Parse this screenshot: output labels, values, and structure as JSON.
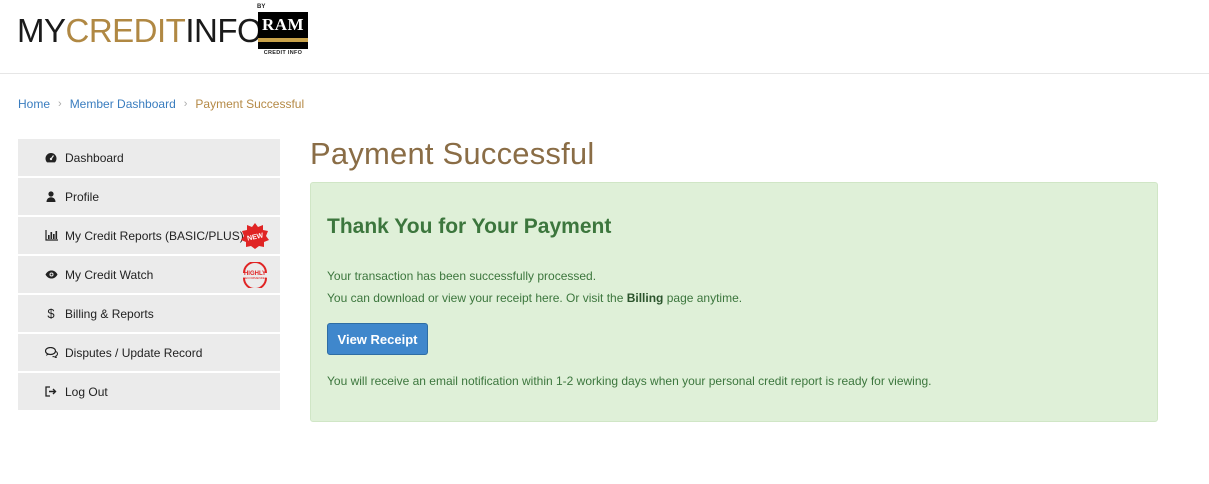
{
  "logo": {
    "my": "MY",
    "credit": "CREDIT",
    "info": "INFO",
    "by": "BY",
    "ram": "RAM",
    "ram_sub": "CREDIT INFO"
  },
  "breadcrumb": {
    "items": [
      "Home",
      "Member Dashboard"
    ],
    "current": "Payment Successful",
    "separator_icon": "chevron-right-icon"
  },
  "sidebar": {
    "items": [
      {
        "label": "Dashboard",
        "icon": "dashboard-icon"
      },
      {
        "label": "Profile",
        "icon": "user-icon"
      },
      {
        "label": "My Credit Reports (BASIC/PLUS)",
        "icon": "bar-chart-icon",
        "badge": "NEW"
      },
      {
        "label": "My Credit Watch",
        "icon": "eye-icon",
        "badge": "HIGHLY RECOMMENDED"
      },
      {
        "label": "Billing & Reports",
        "icon": "dollar-icon"
      },
      {
        "label": "Disputes / Update Record",
        "icon": "comments-icon"
      },
      {
        "label": "Log Out",
        "icon": "sign-out-icon"
      }
    ]
  },
  "main": {
    "title": "Payment Successful",
    "panel": {
      "heading": "Thank You for Your Payment",
      "line1": "Your transaction has been successfully processed.",
      "line2_pre": "You can download or view your receipt here. Or visit the ",
      "line2_bold": "Billing",
      "line2_post": " page anytime.",
      "button_label": "View Receipt",
      "note": "You will receive an email notification within 1-2 working days when your personal credit report is ready for viewing."
    }
  },
  "colors": {
    "brand_gold": "#b08843",
    "link_blue": "#3a7dbf",
    "success_bg": "#dff0d8",
    "success_text": "#3c763d",
    "button_blue": "#3f87cc",
    "badge_red": "#e02424"
  }
}
